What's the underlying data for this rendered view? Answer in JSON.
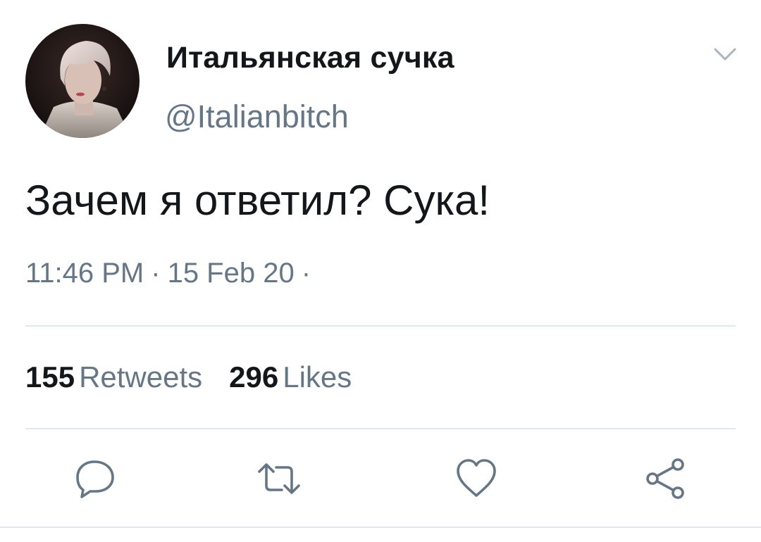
{
  "tweet": {
    "author": {
      "display_name": "Итальянская сучка",
      "handle": "@Italianbitch",
      "avatar": "avatar-photo"
    },
    "caret_icon": "chevron-down-icon",
    "text": "Зачем я ответил? Сука!",
    "meta": {
      "time": "11:46 PM",
      "separator": "·",
      "date": "15 Feb 20",
      "trailing_separator": "·"
    },
    "stats": {
      "retweets_count": "155",
      "retweets_label": "Retweets",
      "likes_count": "296",
      "likes_label": "Likes"
    },
    "actions": [
      {
        "name": "reply",
        "icon": "comment-icon"
      },
      {
        "name": "retweet",
        "icon": "retweet-icon"
      },
      {
        "name": "like",
        "icon": "heart-icon"
      },
      {
        "name": "share",
        "icon": "share-icon"
      }
    ]
  },
  "colors": {
    "text_primary": "#14171a",
    "text_secondary": "#657786",
    "divider": "#e1e8ed",
    "icon": "#657786"
  }
}
